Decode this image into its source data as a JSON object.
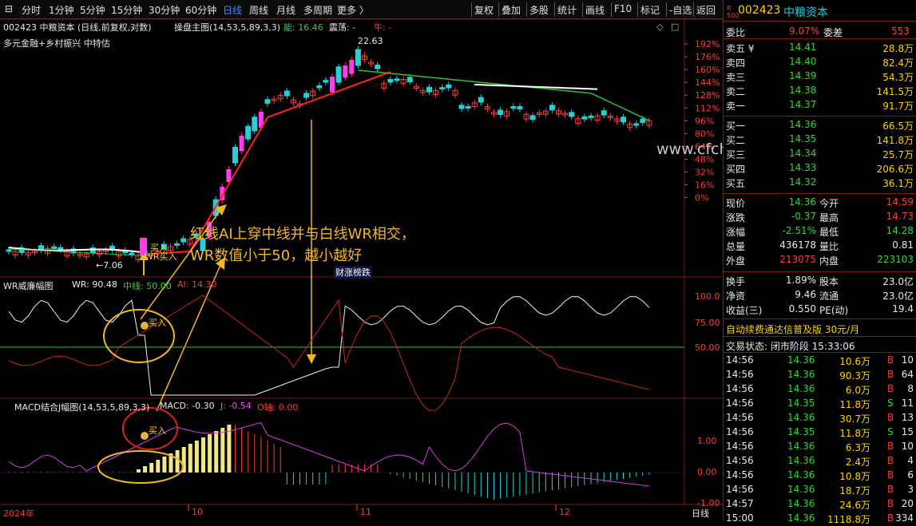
{
  "toolbar": {
    "periods": [
      "分时",
      "1分钟",
      "5分钟",
      "15分钟",
      "30分钟",
      "60分钟",
      "日线",
      "周线",
      "月线",
      "多周期",
      "更多 〉"
    ],
    "active_period": "日线",
    "tools": [
      "复权",
      "叠加",
      "多股",
      "统计",
      "画线",
      "F10",
      "标记",
      "-自选",
      "返回"
    ]
  },
  "chart": {
    "header": {
      "stock": "002423 中粮资本 (日线,前复权,对数)",
      "indicator": "操盘主图(14,53,5,89,3,3)",
      "rise_label": "能: 16.46",
      "swing_label": "震荡: -",
      "bull_label": "牛: -",
      "concepts": "多元金融+乡村振兴 中特估"
    },
    "high_mark": "22.63",
    "low_mark": "←7.06",
    "buy_label": "买入",
    "wr_buy_label": "WR买入",
    "y_ticks": [
      "192%",
      "176%",
      "160%",
      "144%",
      "128%",
      "112%",
      "96%",
      "80%",
      "64%",
      "48%",
      "32%",
      "16%",
      "0%"
    ],
    "annotation_line1": "红线AI上穿中线并与白线WR相交，",
    "annotation_line2": "WR数值小于50，越小越好",
    "badge": "财涨榜跌",
    "watermark": "www.cfchi.com"
  },
  "wr_panel": {
    "title": "WR威廉幅图",
    "wr": "WR: 90.48",
    "mid": "中线: 50.00",
    "ai": "AI: 14.30",
    "buy": "买入",
    "y_ticks": [
      "100.0",
      "75.00",
      "50.00"
    ]
  },
  "macd_panel": {
    "title": "MACD结合J幅图(14,53,5,89,3,3)",
    "macd": "MACD: -0.30",
    "j": "J: -0.54",
    "o": "O轴: 0.00",
    "buy": "买入",
    "y_ticks": [
      "1.00",
      "0.00",
      "-1.00"
    ]
  },
  "time_axis": {
    "labels": [
      "2024年",
      "10",
      "11",
      "12"
    ],
    "period": "日线"
  },
  "quote": {
    "code": "002423",
    "name": "中粮资本",
    "r_badge": "R",
    "r_sub": "500",
    "weibi_label": "委比",
    "weibi": "9.07%",
    "weicha_label": "委差",
    "weicha": "553",
    "asks": [
      {
        "label": "卖五 ¥",
        "price": "14.41",
        "vol": "28.8万"
      },
      {
        "label": "卖四",
        "price": "14.40",
        "vol": "82.4万"
      },
      {
        "label": "卖三",
        "price": "14.39",
        "vol": "54.3万"
      },
      {
        "label": "卖二",
        "price": "14.38",
        "vol": "141.5万"
      },
      {
        "label": "卖一",
        "price": "14.37",
        "vol": "91.7万"
      }
    ],
    "bids": [
      {
        "label": "买一",
        "price": "14.36",
        "vol": "66.5万"
      },
      {
        "label": "买二",
        "price": "14.35",
        "vol": "141.8万"
      },
      {
        "label": "买三",
        "price": "14.34",
        "vol": "25.7万"
      },
      {
        "label": "买四",
        "price": "14.33",
        "vol": "206.6万"
      },
      {
        "label": "买五",
        "price": "14.32",
        "vol": "36.1万"
      }
    ],
    "stats": [
      {
        "l1": "现价",
        "v1": "14.36",
        "c1": "grn",
        "l2": "今开",
        "v2": "14.59",
        "c2": "red"
      },
      {
        "l1": "涨跌",
        "v1": "-0.37",
        "c1": "grn",
        "l2": "最高",
        "v2": "14.73",
        "c2": "red"
      },
      {
        "l1": "涨幅",
        "v1": "-2.51%",
        "c1": "grn",
        "l2": "最低",
        "v2": "14.28",
        "c2": "grn"
      },
      {
        "l1": "总量",
        "v1": "436178",
        "c1": "wht",
        "l2": "量比",
        "v2": "0.81",
        "c2": "wht"
      },
      {
        "l1": "外盘",
        "v1": "213075",
        "c1": "red",
        "l2": "内盘",
        "v2": "223103",
        "c2": "grn"
      }
    ],
    "fund": [
      {
        "l1": "换手",
        "v1": "1.89%",
        "l2": "股本",
        "v2": "23.0亿"
      },
      {
        "l1": "净资",
        "v1": "9.46",
        "l2": "流通",
        "v2": "23.0亿"
      },
      {
        "l1": "收益(三)",
        "v1": "0.550",
        "l2": "PE(动)",
        "v2": "19.4"
      }
    ],
    "promo": "自动续费通达信普及版  30元/月",
    "status": "交易状态: 闭市阶段 15:33:06",
    "ticks": [
      {
        "t": "14:56",
        "p": "14.36",
        "v": "10.6万",
        "d": "B",
        "n": "10"
      },
      {
        "t": "14:56",
        "p": "14.36",
        "v": "90.3万",
        "d": "B",
        "n": "64"
      },
      {
        "t": "14:56",
        "p": "14.36",
        "v": "6.0万",
        "d": "B",
        "n": "8"
      },
      {
        "t": "14:56",
        "p": "14.35",
        "v": "11.8万",
        "d": "S",
        "n": "11"
      },
      {
        "t": "14:56",
        "p": "14.36",
        "v": "30.7万",
        "d": "B",
        "n": "13"
      },
      {
        "t": "14:56",
        "p": "14.35",
        "v": "11.8万",
        "d": "S",
        "n": "15"
      },
      {
        "t": "14:56",
        "p": "14.36",
        "v": "6.3万",
        "d": "B",
        "n": "10"
      },
      {
        "t": "14:56",
        "p": "14.36",
        "v": "2.4万",
        "d": "B",
        "n": "4"
      },
      {
        "t": "14:56",
        "p": "14.36",
        "v": "10.8万",
        "d": "B",
        "n": "6"
      },
      {
        "t": "14:56",
        "p": "14.36",
        "v": "18.7万",
        "d": "B",
        "n": "3"
      },
      {
        "t": "14:57",
        "p": "14.36",
        "v": "24.6万",
        "d": "B",
        "n": "20"
      },
      {
        "t": "15:00",
        "p": "14.36",
        "v": "1118.8万",
        "d": "B",
        "n": "334"
      }
    ]
  }
}
